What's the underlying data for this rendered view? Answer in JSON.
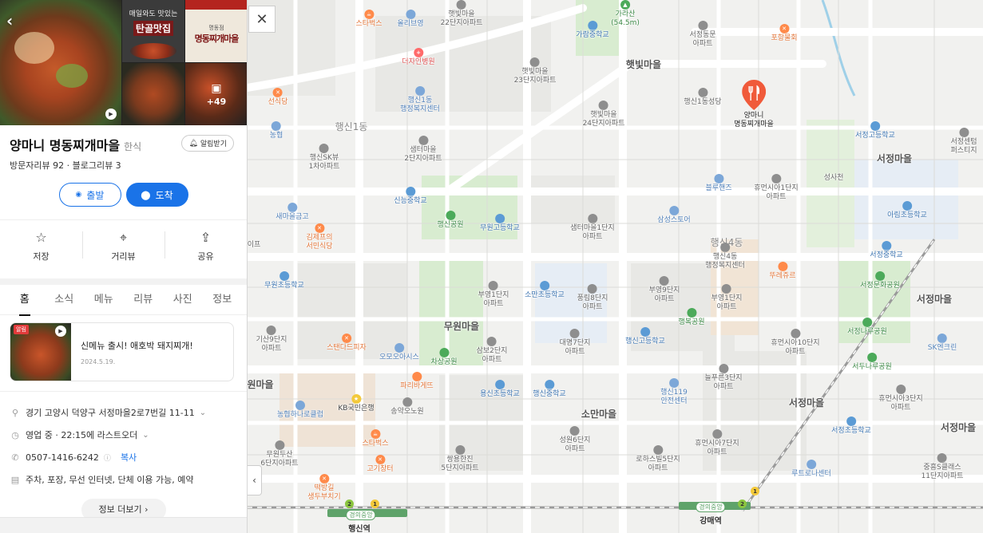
{
  "panel": {
    "photos": {
      "tile1_line1": "매일와도 맛있는",
      "tile1_line2": "탄골맛집",
      "tile2_text": "명동찌개마을",
      "tile2_small": "명동점",
      "more_count": "+49"
    },
    "place_name": "양마니 명동찌개마을",
    "category": "한식",
    "alarm_label": "알림받기",
    "reviews": "방문자리뷰 92 · 블로그리뷰 3",
    "route": {
      "start_label": "출발",
      "dest_label": "도착"
    },
    "actions": [
      {
        "label": "저장",
        "icon": "star-icon"
      },
      {
        "label": "거리뷰",
        "icon": "location-pin-icon"
      },
      {
        "label": "공유",
        "icon": "share-icon"
      }
    ],
    "tabs": [
      "홈",
      "소식",
      "메뉴",
      "리뷰",
      "사진",
      "정보"
    ],
    "active_tab": "홈",
    "news": {
      "badge": "알림",
      "title": "신메뉴 출시! 애호박 돼지찌개!",
      "date": "2024.5.19."
    },
    "info": {
      "address": "경기 고양시 덕양구 서정마을2로7번길 11-11",
      "hours": "영업 중 · 22:15에 라스트오더",
      "phone": "0507-1416-6242",
      "copy_label": "복사",
      "amenities": "주차, 포장, 무선 인터넷, 단체 이용 가능, 예약"
    },
    "more_info_label": "정보 더보기"
  },
  "map": {
    "pin_label_1": "양마니",
    "pin_label_2": "명동찌개마을",
    "areas": {
      "haengsin1": "행신1동",
      "haengsin4": "행신4동",
      "mowon": "무원마을",
      "somanmaeul": "소만마을",
      "seojeong1": "서정마을",
      "seojeong2": "서정마을",
      "seojeong3": "서정마을",
      "seojeong4": "서정마을",
      "haetbit": "햇빛마을",
      "wonmaeul": "원마을"
    },
    "pois": {
      "starbucks1": "스타벅스",
      "olive": "올리브영",
      "haetbit22": "햇빛마을\n22단지아파트",
      "haetbit23": "햇빛마을\n23단지아파트",
      "haetbit24": "햇빛마을\n24단지아파트",
      "gaheung": "가람중학교",
      "garasan": "가라산\n(54.5m)",
      "seojeongdong": "서정동문\n아파트",
      "pohang": "포항물회",
      "dejain": "더자인병원",
      "haengsin1welfare": "행신1동\n행정복지센터",
      "seondae": "선식당",
      "nonghyup": "농협",
      "sk": "행신SK뷰\n1차아파트",
      "saetteo2": "샘터마을\n2단지아파트",
      "sinneung": "신능중학교",
      "haengsin1seongdang": "행신1동성당",
      "bluehands": "블루핸즈",
      "humansia1": "휴먼시아1단지\n아파트",
      "seongsachan": "성사천",
      "seojeonghigh": "서정고등학교",
      "seojeongcenter": "서정센텀\n퍼스티지",
      "saemaul": "새마을금고",
      "haengsinpark": "행신공원",
      "mowonhigh": "무원고등학교",
      "saetteo1": "샘터마을1단지\n아파트",
      "samsung": "삼성스토어",
      "haengsin4welfare": "행신4동\n행정복지센터",
      "ahrim": "아림초등학교",
      "kimsep": "김제프의\n서민식당",
      "seojeongmiddle": "서정중학교",
      "ipe": "이프",
      "mowonelem": "무원초등학교",
      "buyoung1": "부영1단지\n아파트",
      "soman": "소만초등학교",
      "pungrim": "풍림8단지\n아파트",
      "buyoung9": "부영9단지\n아파트",
      "buyoung10": "부영1단지\n아파트",
      "seojeongmunhwa": "서정문화공원",
      "twojeu": "뚜레쥬르",
      "happypark": "행복공원",
      "gisan9": "기산9단지\n아파트",
      "standard": "스탠다드피자",
      "daemyeong7": "대명7단지\n아파트",
      "samboo2": "삼보2단지\n아파트",
      "ohmoya": "오모오아시스",
      "chasungpark": "차상공원",
      "haengsinhigh": "행신고등학교",
      "humansia10": "휴먼시아10단지\n아파트",
      "seojeongnaru": "서정나루공원",
      "seodunaru": "서두나루공원",
      "skcenter": "SK엔크린",
      "nupeureun": "늘푸른3단지\n아파트",
      "humansia3": "휴먼시아3단지\n아파트",
      "paris": "파리바게뜨",
      "kb": "KB국민은행",
      "songya": "송약오노원",
      "yongsin": "용신초등학교",
      "haengsinmiddle": "행신중학교",
      "fire119": "행신119\n안전센터",
      "nonghyup2": "농협하나로클럽",
      "mowon6": "무원두산\n6단지아파트",
      "starbucks2": "스타벅스",
      "gogi": "고기창터",
      "ssangyong": "쌍용한진\n5단지아파트",
      "seongwon6": "성원6단지\n아파트",
      "rohasville": "로하스빌5단지\n아파트",
      "humansia7": "휴먼시아7단지\n아파트",
      "seojeongelem": "서정초등학교",
      "jungheung": "중흥S클래스\n11단지아파트",
      "lutreunaru": "루트로나센터",
      "tteokbokki": "떡방길\n생두부치기"
    },
    "stations": {
      "haengsin": "행신역",
      "gangmae": "강매역",
      "line_name1": "경의중앙",
      "line_name2": "경의중앙",
      "line_num_a": "2",
      "line_num_b": "1",
      "line_num_c": "2",
      "line_num_d": "1"
    }
  },
  "colors": {
    "accent": "#1a73e8",
    "pin": "#f05a3a",
    "park": "#d8ecd0",
    "road": "#ffffff"
  }
}
